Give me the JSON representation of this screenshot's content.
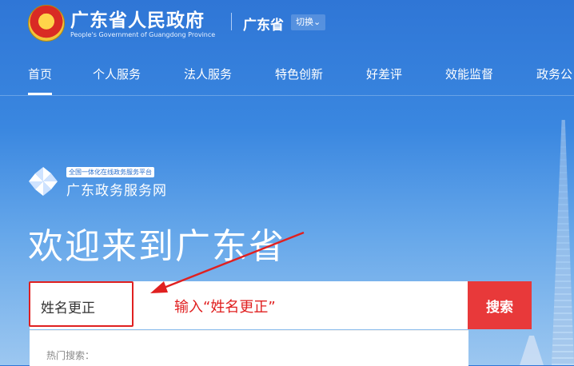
{
  "header": {
    "title": "广东省人民政府",
    "subtitle": "People's Government of Guangdong Province",
    "province": "广东省",
    "switch_label": "切换"
  },
  "nav": {
    "items": [
      "首页",
      "个人服务",
      "法人服务",
      "特色创新",
      "好差评",
      "效能监督",
      "政务公"
    ],
    "active": "首页"
  },
  "brand": {
    "tag": "全国一体化在线政务服务平台",
    "name": "广东政务服务网"
  },
  "welcome": "欢迎来到广东省",
  "search": {
    "value": "姓名更正",
    "button_label": "搜索",
    "hot_label": "热门搜索："
  },
  "annotation": {
    "text": "输入“姓名更正”",
    "color": "#e02020"
  },
  "colors": {
    "accent": "#2f76d6",
    "search_button": "#e8393a"
  }
}
